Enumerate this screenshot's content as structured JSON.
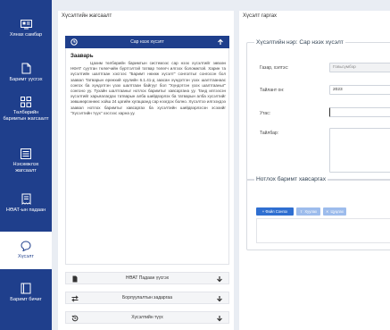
{
  "sidebar": {
    "items": [
      {
        "label": "Хянах самбар",
        "icon": "dashboard-icon"
      },
      {
        "label": "Баримт үүсгэх",
        "icon": "document-icon"
      },
      {
        "label": "Төлбөрийн баримтын жагсаалт",
        "icon": "grid-list-icon"
      },
      {
        "label": "Нэхэмжлэх жагсаалт",
        "icon": "list-icon"
      },
      {
        "label": "НӨАТ-ын падаан",
        "icon": "receipt-icon"
      },
      {
        "label": "Хүсэлт",
        "icon": "chat-icon"
      },
      {
        "label": "Баримт бичиг",
        "icon": "folder-icon"
      }
    ]
  },
  "left_panel": {
    "title": "Хүсэлтийн жагсаалт",
    "accordion": [
      {
        "label": "Сар нээх хүсэлт",
        "icon": "clock-icon",
        "arrow": "arrow-up-icon"
      },
      {
        "label": "НӨАТ Падаан үүсгэх",
        "icon": "file-icon",
        "arrow": "arrow-down-icon"
      },
      {
        "label": "Борлуулалтын задаргаа",
        "icon": "exchange-icon",
        "arrow": "arrow-down-icon"
      },
      {
        "label": "Хүсэлтийн түүх",
        "icon": "history-icon",
        "arrow": "arrow-down-icon"
      }
    ],
    "note": {
      "title": "Зааварь",
      "body": "Цахим төлбөрийн баримтын системээс сар нээх хүсэлтийг зөвхөн НӨАТ суутган төлөгчийн бүртгэлтэй татвар төлөгч илгээх боломжтой. Харин та хүсэлтийн шалтгаан хэсгээс \"Баримт нөхөж хүсэлт\" сонголтыг сонгосон бол заавал Татварын ерөнхий хуулийн 6.1.41-д заасан хүндэтгэн үзэх шалтгаанаас сонгох ба хүндэтгэн үзэх шалтгаан байгууг бол \"Хүндэтгэн үзэх шалтгааныг\" сонгоно уу. Тухайн шалтгааныг нотлох баримтыг хавсаргана уу. Танд илгээсэн хүсэлтийг харьяалагдах татварын алба шийдвэрлэх ба татварын алба хүсэлтийг зөвшөөрсөнөөс хойш 24 цагийн хугацаанд сар нээгдэх болно. Хүсэлтээ илгээхдээ заавал нотлох баримтыг хавсаргах ба хүсэлтийн шийдвэрлэсэн эсэхийг \"Хүсэлтийн түүх\" хэсгээс харна уу."
    }
  },
  "right_panel": {
    "title": "Хүсэлт гаргах",
    "request_legend": "Хүсэлтийн нэр: Сар нээх хүсэлт",
    "fields": [
      {
        "label": "Газар, хэлтэс:",
        "value": "Говьсүмбэр",
        "disabled": true
      },
      {
        "label": "Тайлант он:",
        "value": "2023",
        "disabled": false
      },
      {
        "label": "Утас:",
        "value": "",
        "disabled": false
      },
      {
        "label": "Тайлбар:",
        "value": "",
        "disabled": false
      }
    ],
    "attach_legend": "Нотлох баримт хавсаргах",
    "buttons": [
      {
        "label": "+ Файл Сонгох",
        "icon": "plus-icon"
      },
      {
        "label": "Хуулах",
        "icon": "upload-icon"
      },
      {
        "label": "Цуцлах",
        "icon": "close-icon"
      }
    ]
  }
}
